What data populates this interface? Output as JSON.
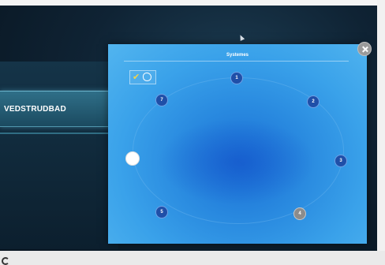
{
  "background_window": {
    "bar_label": "VEDSTRUDBAD"
  },
  "dialog": {
    "title": "Systemes",
    "accent_color": "#2a8be0",
    "toolbar": {
      "check_icon": "check-icon",
      "hand_icon": "hand-icon"
    },
    "close_icon": "close-icon"
  },
  "nodes": [
    {
      "label": "1",
      "color": "#1f4fa8"
    },
    {
      "label": "2",
      "color": "#1f4fa8"
    },
    {
      "label": "3",
      "color": "#1f4fa8"
    },
    {
      "label": "4",
      "color": "#8c8c8c"
    },
    {
      "label": "5",
      "color": "#1f4fa8"
    },
    {
      "label": "",
      "color": "#ffffff"
    },
    {
      "label": "7",
      "color": "#1f4fa8"
    }
  ]
}
